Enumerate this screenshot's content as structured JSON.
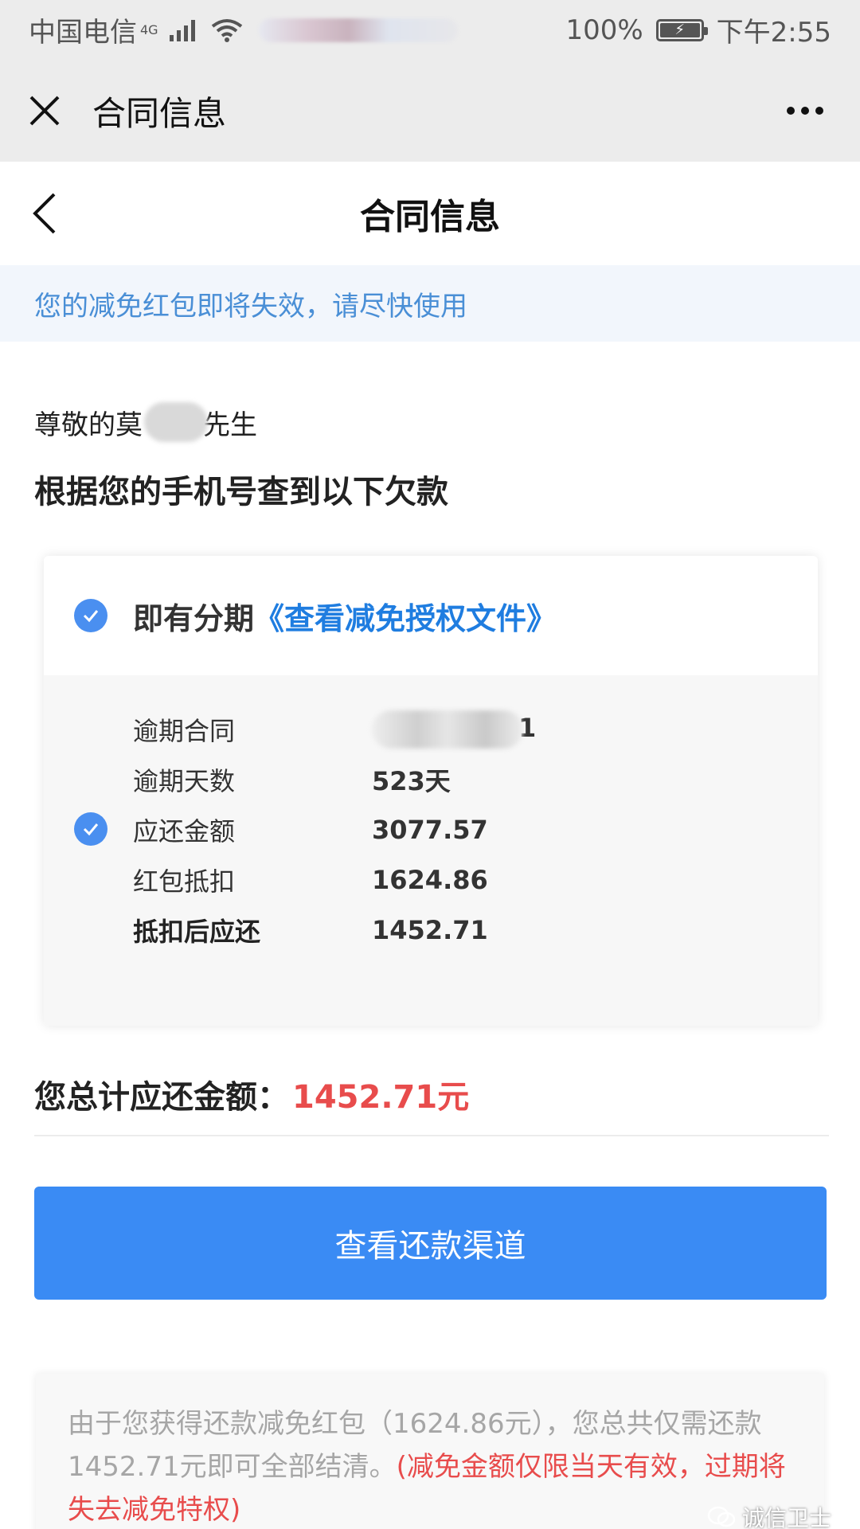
{
  "status_bar": {
    "carrier": "中国电信",
    "network": "4G",
    "battery": "100%",
    "time": "下午2:55"
  },
  "wx_bar": {
    "title": "合同信息"
  },
  "header": {
    "title": "合同信息"
  },
  "notice": {
    "text": "您的减免红包即将失效，请尽快使用"
  },
  "greeting": {
    "prefix": "尊敬的莫",
    "suffix": "先生",
    "subtitle": "根据您的手机号查到以下欠款"
  },
  "card": {
    "product": "即有分期",
    "doc_link": "《查看减免授权文件》",
    "rows": [
      {
        "label": "逾期合同",
        "value": "1"
      },
      {
        "label": "逾期天数",
        "value": "523天"
      },
      {
        "label": "应还金额",
        "value": "3077.57"
      },
      {
        "label": "红包抵扣",
        "value": "1624.86"
      },
      {
        "label": "抵扣后应还",
        "value": "1452.71"
      }
    ]
  },
  "total": {
    "label": "您总计应还金额：",
    "amount": "1452.71元"
  },
  "pay_button": {
    "label": "查看还款渠道"
  },
  "note": {
    "text": "由于您获得还款减免红包（1624.86元），您总共仅需还款1452.71元即可全部结清。",
    "highlight": "(减免金额仅限当天有效，过期将失去减免特权)"
  },
  "watermark": {
    "text": "诚信卫士"
  },
  "colors": {
    "accent_blue": "#3a8bf4",
    "link_blue": "#1f7de0",
    "notice_blue": "#4a8fd6",
    "amount_red": "#e84c4c"
  }
}
